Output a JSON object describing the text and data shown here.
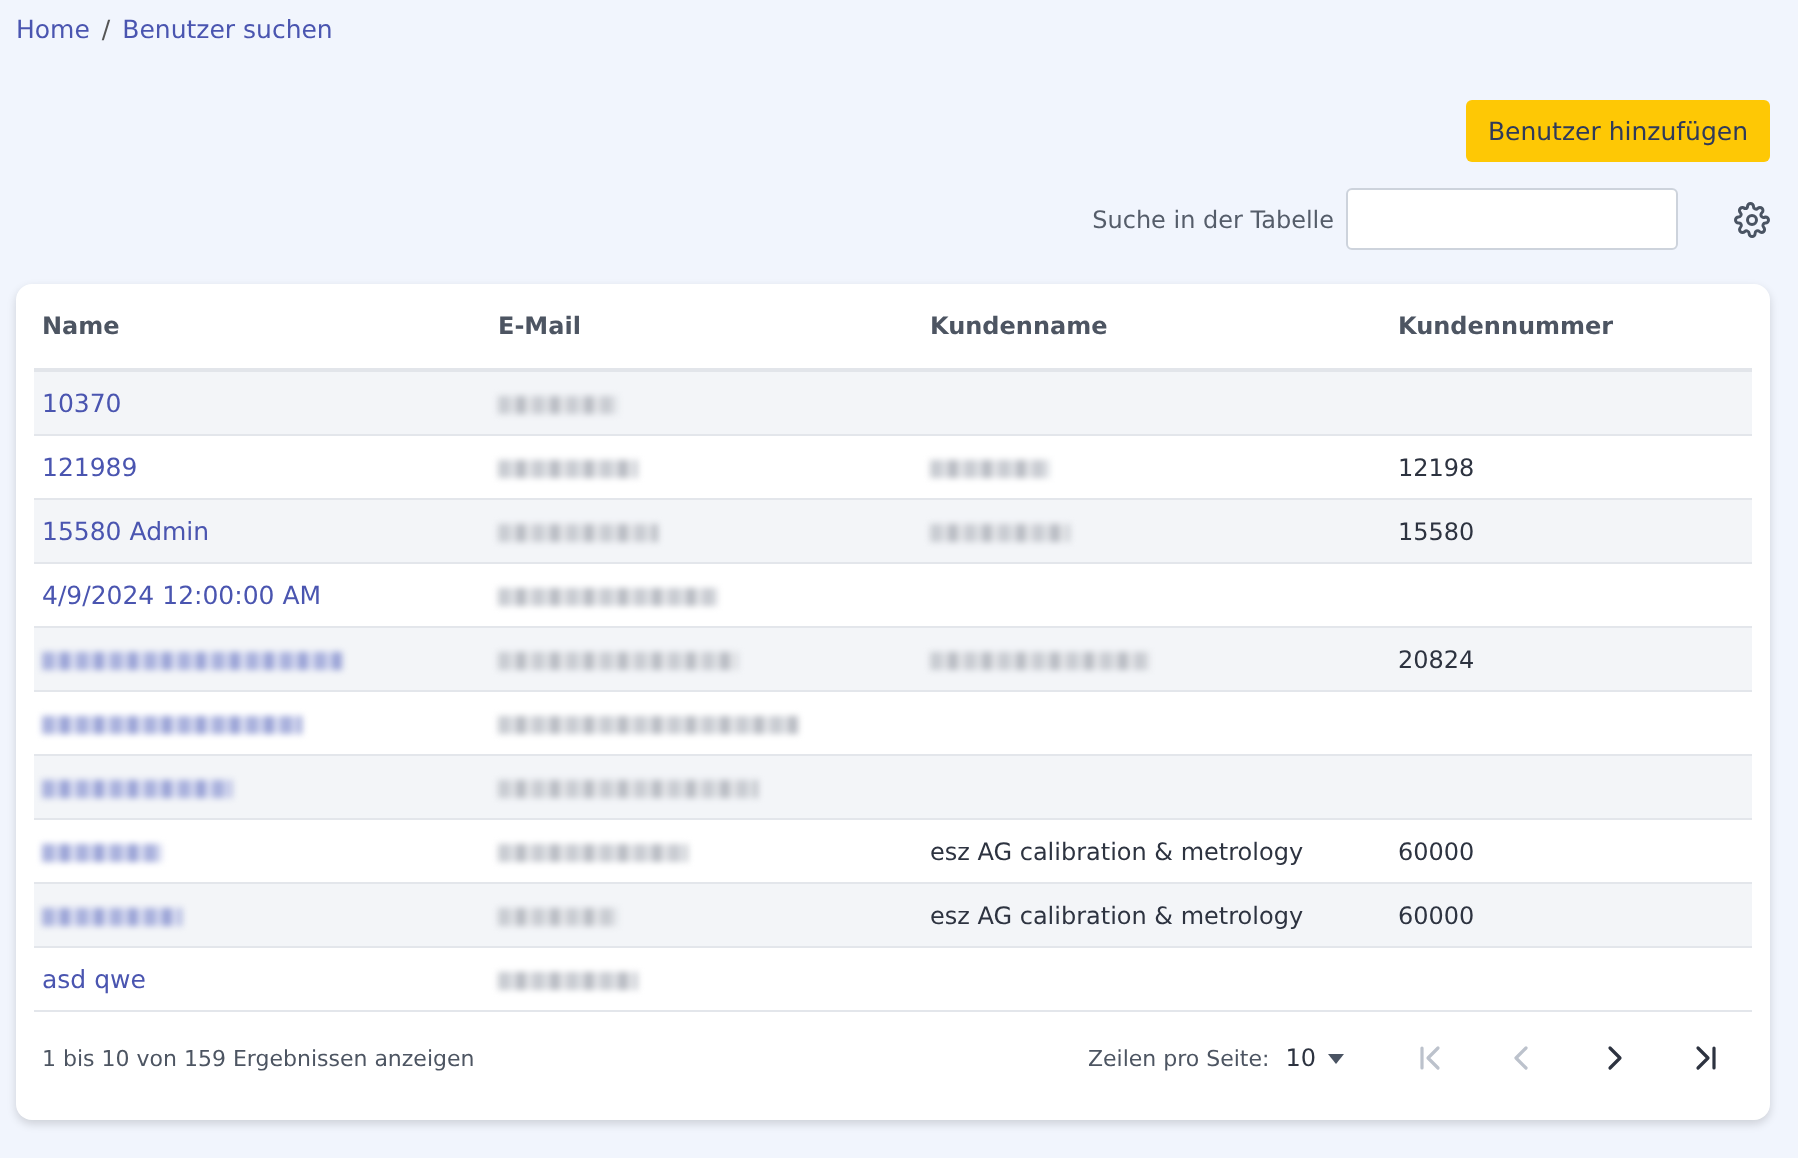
{
  "breadcrumb": [
    {
      "label": "Home"
    },
    {
      "label": "Benutzer suchen"
    }
  ],
  "breadcrumb_separator": "/",
  "add_button": {
    "label": "Benutzer hinzufügen"
  },
  "search": {
    "label": "Suche in der Tabelle"
  },
  "table": {
    "columns": [
      "Name",
      "E-Mail",
      "Kundenname",
      "Kundennummer"
    ],
    "rows": [
      {
        "cells": [
          {
            "kind": "link",
            "text": "10370"
          },
          {
            "kind": "blurred"
          },
          {
            "kind": "empty"
          },
          {
            "kind": "empty"
          }
        ]
      },
      {
        "cells": [
          {
            "kind": "link",
            "text": "121989"
          },
          {
            "kind": "blurred"
          },
          {
            "kind": "blurred"
          },
          {
            "kind": "text",
            "text": "12198"
          }
        ]
      },
      {
        "cells": [
          {
            "kind": "link",
            "text": "15580 Admin"
          },
          {
            "kind": "blurred"
          },
          {
            "kind": "blurred"
          },
          {
            "kind": "text",
            "text": "15580"
          }
        ]
      },
      {
        "cells": [
          {
            "kind": "link",
            "text": "4/9/2024 12:00:00 AM"
          },
          {
            "kind": "blurred"
          },
          {
            "kind": "empty"
          },
          {
            "kind": "empty"
          }
        ]
      },
      {
        "cells": [
          {
            "kind": "blurred"
          },
          {
            "kind": "blurred"
          },
          {
            "kind": "blurred"
          },
          {
            "kind": "text",
            "text": "20824"
          }
        ]
      },
      {
        "cells": [
          {
            "kind": "blurred"
          },
          {
            "kind": "blurred"
          },
          {
            "kind": "empty"
          },
          {
            "kind": "empty"
          }
        ]
      },
      {
        "cells": [
          {
            "kind": "blurred"
          },
          {
            "kind": "blurred"
          },
          {
            "kind": "empty"
          },
          {
            "kind": "empty"
          }
        ]
      },
      {
        "cells": [
          {
            "kind": "blurred"
          },
          {
            "kind": "blurred"
          },
          {
            "kind": "text",
            "text": "esz AG calibration & metrology"
          },
          {
            "kind": "text",
            "text": "60000"
          }
        ]
      },
      {
        "cells": [
          {
            "kind": "blurred"
          },
          {
            "kind": "blurred"
          },
          {
            "kind": "text",
            "text": "esz AG calibration & metrology"
          },
          {
            "kind": "text",
            "text": "60000"
          }
        ]
      },
      {
        "cells": [
          {
            "kind": "link",
            "text": "asd qwe"
          },
          {
            "kind": "blurred"
          },
          {
            "kind": "empty"
          },
          {
            "kind": "empty"
          }
        ]
      }
    ]
  },
  "footer": {
    "summary": "1 bis 10 von 159 Ergebnissen anzeigen",
    "rows_label": "Zeilen pro Seite:",
    "rows_value": "10",
    "pager": [
      {
        "kind": "first",
        "disabled": true
      },
      {
        "kind": "prev",
        "disabled": true
      },
      {
        "kind": "next",
        "disabled": false
      },
      {
        "kind": "last",
        "disabled": false
      }
    ]
  }
}
